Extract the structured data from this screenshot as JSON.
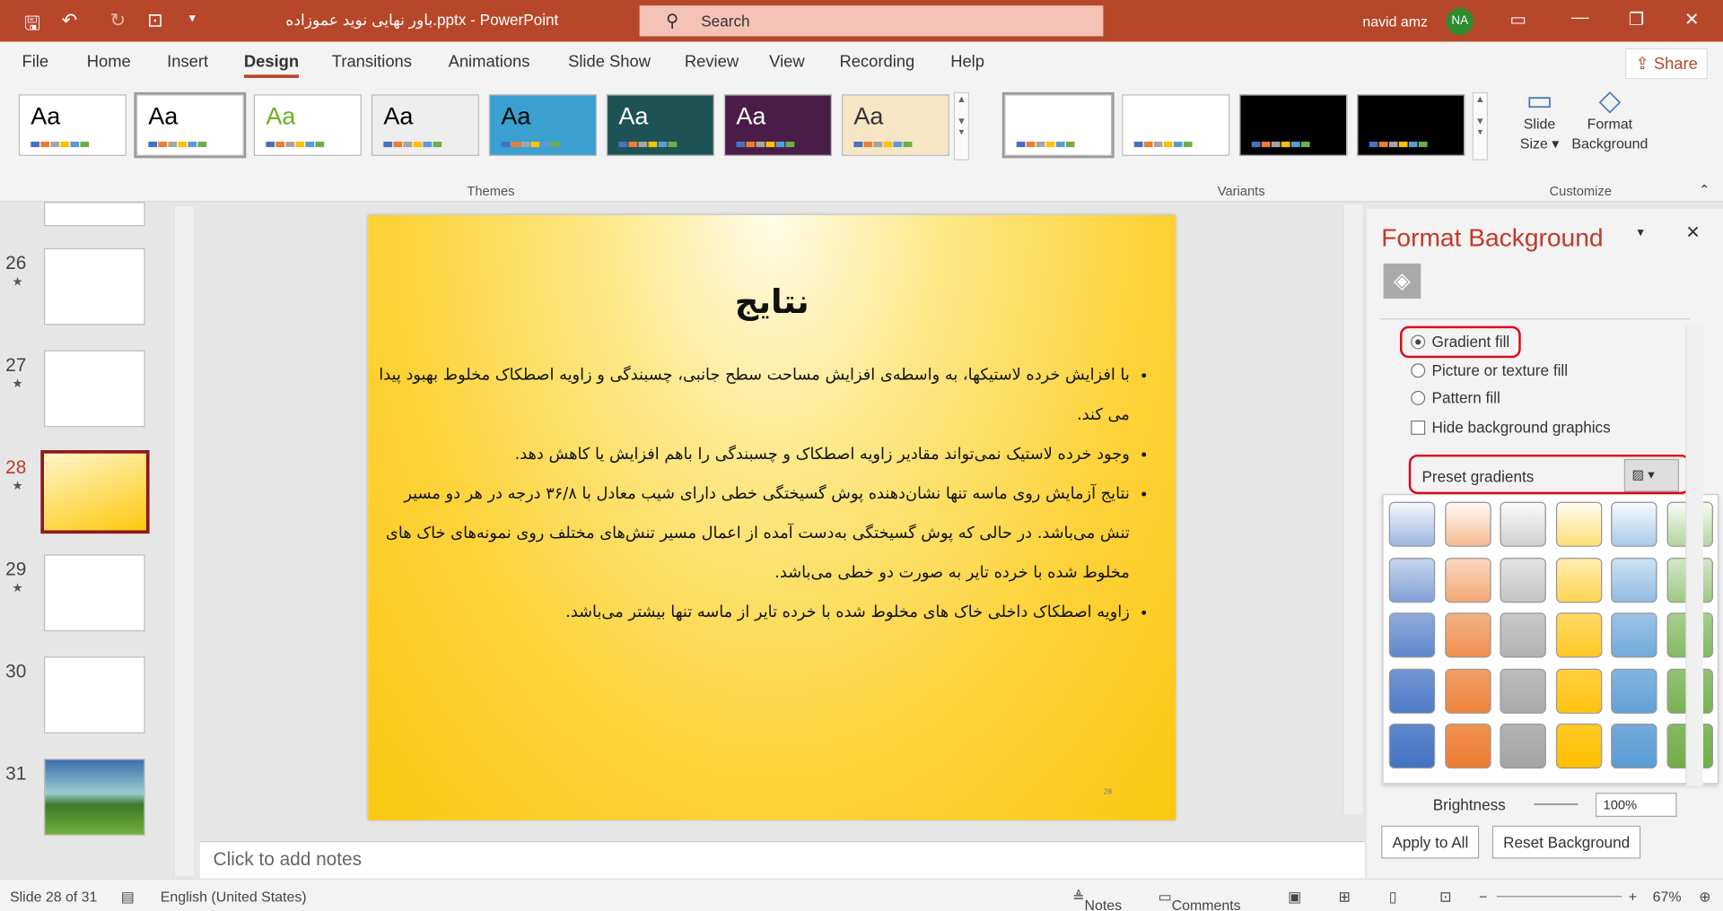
{
  "titlebar": {
    "filename": "باور نهایی نوید عموزاده.pptx",
    "app": "PowerPoint",
    "separator": "-",
    "search_placeholder": "Search",
    "user": "navid amz",
    "initials": "NA"
  },
  "tabs": [
    "File",
    "Home",
    "Insert",
    "Design",
    "Transitions",
    "Animations",
    "Slide Show",
    "Review",
    "View",
    "Recording",
    "Help"
  ],
  "active_tab": "Design",
  "share_label": "Share",
  "ribbon": {
    "themes_label": "Themes",
    "variants_label": "Variants",
    "customize_label": "Customize",
    "theme_sample": "Aa",
    "slide_size_label": "Slide Size",
    "format_background_label": "Format Background"
  },
  "thumbnails": [
    {
      "num": "26",
      "star": "★"
    },
    {
      "num": "27",
      "star": "★"
    },
    {
      "num": "28",
      "star": "★",
      "selected": true
    },
    {
      "num": "29",
      "star": "★"
    },
    {
      "num": "30",
      "star": ""
    },
    {
      "num": "31",
      "star": ""
    }
  ],
  "slide": {
    "title": "نتایج",
    "bullets": [
      "با افزایش خرده لاستیکها، به واسطه‌ی افزایش مساحت سطح جانبی، چسبندگی و زاویه اصطکاک مخلوط بهبود پیدا می کند.",
      "وجود خرده لاستیک نمی‌تواند مقادیر زاویه اصطکاک و چسبندگی را باهم افزایش یا کاهش دهد.",
      "نتایج آزمایش روی ماسه تنها نشان‌دهنده پوش گسیختگی خطی دارای شیب معادل با ۳۶/۸ درجه در هر دو مسیر تنش می‌باشد. در حالی که پوش گسیختگی به‌دست آمده از اعمال مسیر تنش‌های مختلف روی نمونه‌های خاک های مخلوط شده با خرده تایر به صورت دو خطی می‌باشد.",
      "زاویه اصطکاک داخلی خاک های مخلوط شده با خرده تایر از ماسه تنها بیشتر می‌باشد."
    ],
    "page_number": "28"
  },
  "notes_placeholder": "Click to add notes",
  "panel": {
    "title": "Format Background",
    "options": [
      "Gradient fill",
      "Picture or texture fill",
      "Pattern fill"
    ],
    "selected_option": "Gradient fill",
    "hide_graphics": "Hide background graphics",
    "preset_label": "Preset gradients",
    "brightness_label": "Brightness",
    "brightness_value": "100%",
    "apply_all": "Apply to All",
    "reset": "Reset Background",
    "gradient_colors": [
      "#4472c4",
      "#ed7d31",
      "#a5a5a5",
      "#ffc000",
      "#5b9bd5",
      "#70ad47"
    ]
  },
  "status": {
    "slide": "Slide 28 of 31",
    "language": "English (United States)",
    "notes": "Notes",
    "comments": "Comments",
    "zoom": "67%"
  },
  "colors": {
    "accent": "#b7472a",
    "highlight": "#e0001b"
  }
}
